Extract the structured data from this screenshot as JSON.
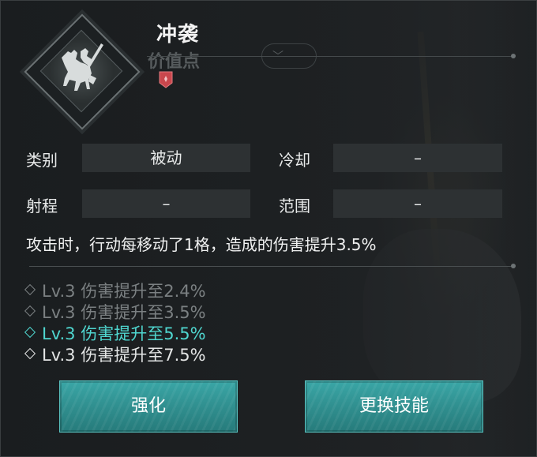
{
  "skill": {
    "name": "冲袭",
    "ghost_label": "价值点"
  },
  "attributes": {
    "category_label": "类别",
    "category_value": "被动",
    "cooldown_label": "冷却",
    "cooldown_value": "–",
    "range_label": "射程",
    "range_value": "–",
    "area_label": "范围",
    "area_value": "–"
  },
  "description": "攻击时，行动每移动了1格，造成的伤害提升3.5%",
  "levels": [
    {
      "text": "Lv.3 伤害提升至2.4%",
      "state": "dim"
    },
    {
      "text": "Lv.3 伤害提升至3.5%",
      "state": "dim"
    },
    {
      "text": "Lv.3 伤害提升至5.5%",
      "state": "active"
    },
    {
      "text": "Lv.3 伤害提升至7.5%",
      "state": "normal"
    }
  ],
  "buttons": {
    "enhance": "强化",
    "replace": "更换技能"
  },
  "colors": {
    "accent": "#4fd6cf",
    "button": "#2f8d8d",
    "gem": "#c9474d"
  },
  "icons": {
    "skill": "knight-on-horse-icon",
    "gem": "red-gem-icon"
  }
}
